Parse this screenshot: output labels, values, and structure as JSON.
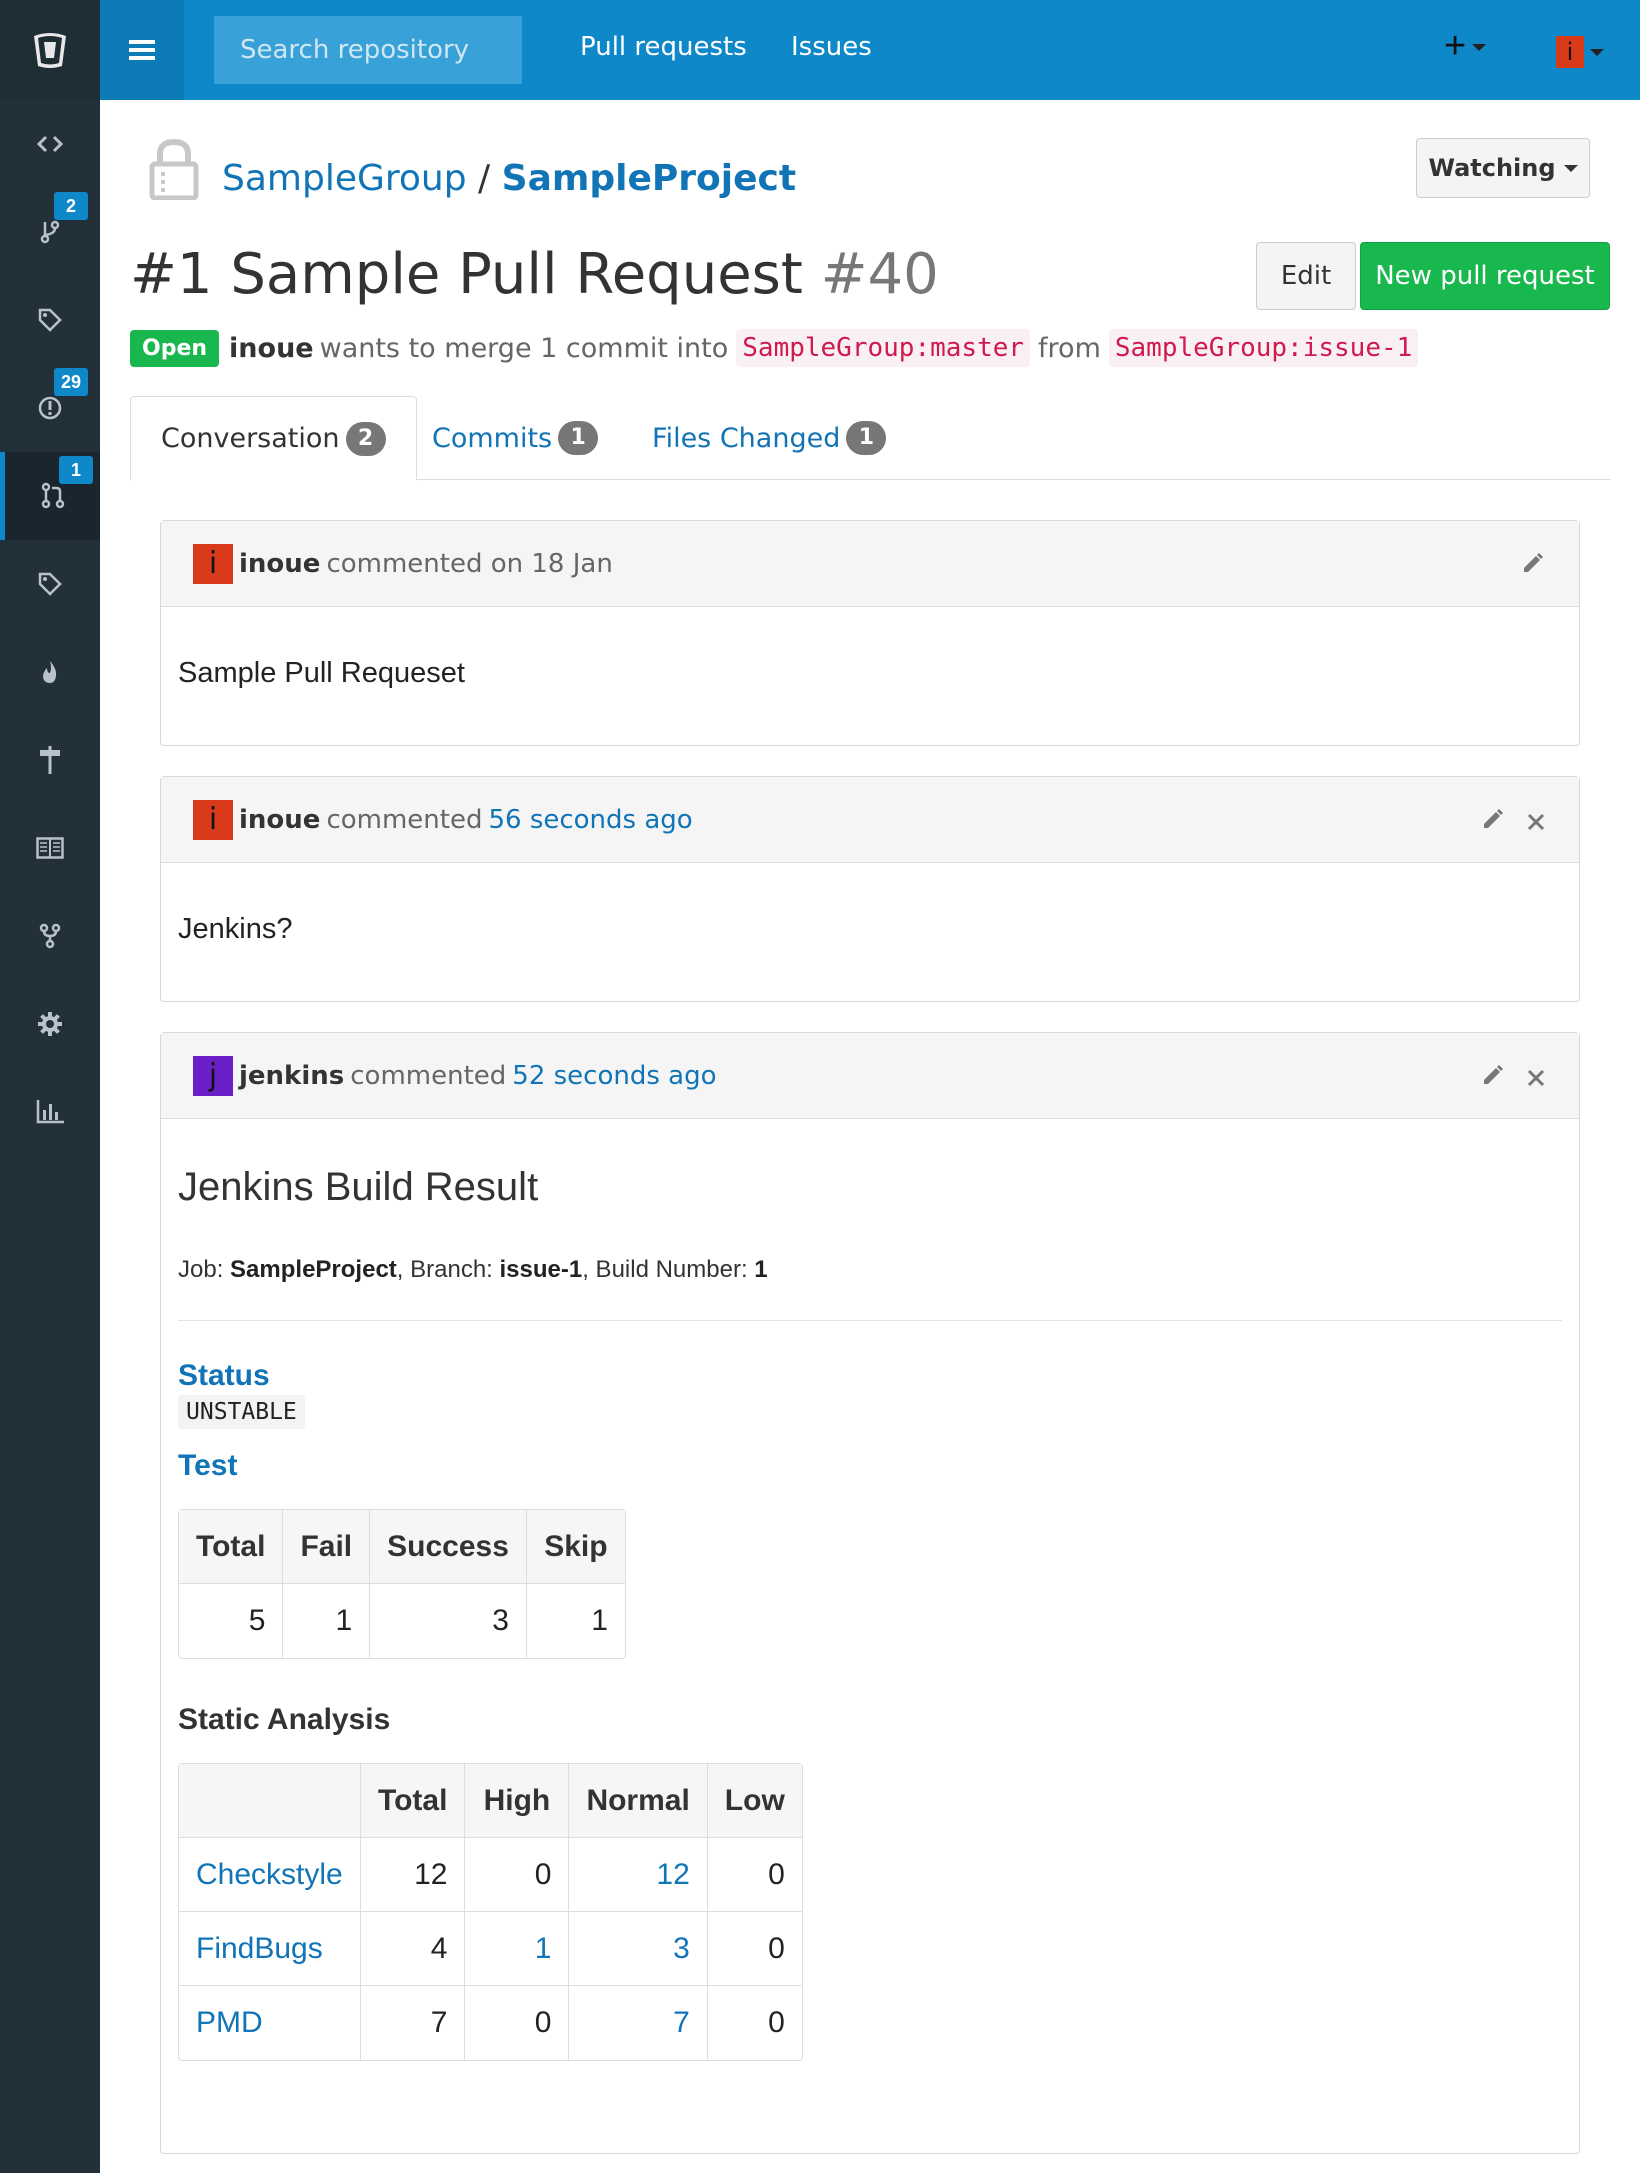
{
  "topbar": {
    "search_placeholder": "Search repository",
    "nav": [
      "Pull requests",
      "Issues"
    ],
    "plus": "+",
    "user_initial": "i"
  },
  "sidebar": {
    "badges": {
      "branches": "2",
      "issues": "29",
      "pulls": "1"
    }
  },
  "repo": {
    "group": "SampleGroup",
    "separator": "/",
    "name": "SampleProject",
    "watch_label": "Watching"
  },
  "pr": {
    "title": "#1 Sample Pull Request",
    "number": "#40",
    "edit_label": "Edit",
    "new_label": "New pull request",
    "status": "Open",
    "author": "inoue",
    "merge_text": "wants to merge 1 commit into",
    "target_branch": "SampleGroup:master",
    "from_text": "from",
    "source_branch": "SampleGroup:issue-1"
  },
  "tabs": [
    {
      "label": "Conversation",
      "count": "2"
    },
    {
      "label": "Commits",
      "count": "1"
    },
    {
      "label": "Files Changed",
      "count": "1"
    }
  ],
  "comments": [
    {
      "initial": "i",
      "author": "inoue",
      "action": "commented on 18 Jan",
      "time": "",
      "body": "Sample Pull Requeset"
    },
    {
      "initial": "i",
      "author": "inoue",
      "action": "commented",
      "time": "56 seconds ago",
      "body": "Jenkins?"
    },
    {
      "initial": "j",
      "author": "jenkins",
      "action": "commented",
      "time": "52 seconds ago",
      "body": ""
    }
  ],
  "jenkins": {
    "title": "Jenkins Build Result",
    "job_label": "Job:",
    "job": "SampleProject",
    "branch_label": ", Branch:",
    "branch": "issue-1",
    "build_label": ", Build Number:",
    "build": "1",
    "status_heading": "Status",
    "status_value": "UNSTABLE",
    "test_heading": "Test",
    "test_headers": [
      "Total",
      "Fail",
      "Success",
      "Skip"
    ],
    "test_values": [
      "5",
      "1",
      "3",
      "1"
    ],
    "sa_heading": "Static Analysis",
    "sa_headers": [
      "",
      "Total",
      "High",
      "Normal",
      "Low"
    ],
    "sa_rows": [
      [
        "Checkstyle",
        "12",
        "0",
        "12",
        "0"
      ],
      [
        "FindBugs",
        "4",
        "1",
        "3",
        "0"
      ],
      [
        "PMD",
        "7",
        "0",
        "7",
        "0"
      ]
    ]
  },
  "colors": {
    "topbar": "#0e88c8",
    "sidebar": "#22303a",
    "link": "#1174b6",
    "success": "#18b84e",
    "avatar_inoue": "#d93a1a",
    "avatar_jenkins": "#6a1fc9"
  }
}
